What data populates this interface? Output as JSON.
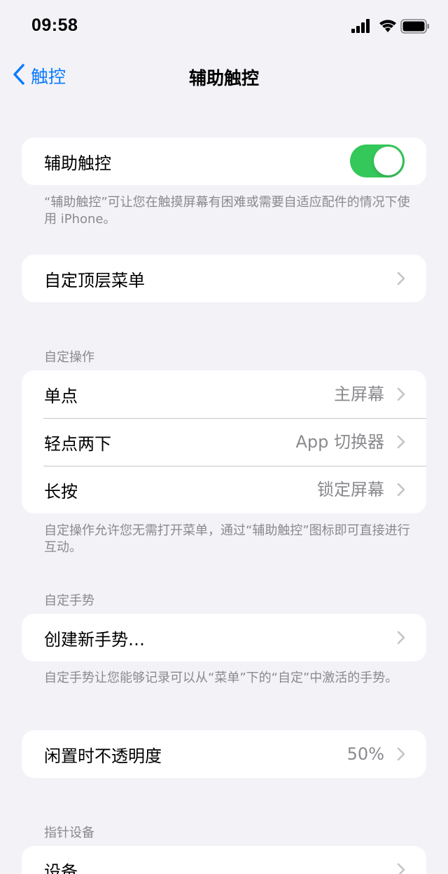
{
  "status_bar": {
    "time": "09:58",
    "icons": [
      "signal-icon",
      "wifi-icon",
      "battery-icon"
    ]
  },
  "nav": {
    "back_label": "触控",
    "title": "辅助触控"
  },
  "assistive_touch": {
    "label": "辅助触控",
    "toggle_on": true,
    "footer": "“辅助触控”可让您在触摸屏幕有困难或需要自适应配件的情况下使用 iPhone。"
  },
  "top_menu": {
    "label": "自定顶层菜单"
  },
  "custom_actions": {
    "header": "自定操作",
    "rows": [
      {
        "label": "单点",
        "value": "主屏幕"
      },
      {
        "label": "轻点两下",
        "value": "App 切换器"
      },
      {
        "label": "长按",
        "value": "锁定屏幕"
      }
    ],
    "footer": "自定操作允许您无需打开菜单，通过“辅助触控”图标即可直接进行互动。"
  },
  "custom_gestures": {
    "header": "自定手势",
    "create_label": "创建新手势…",
    "footer": "自定手势让您能够记录可以从“菜单”下的“自定”中激活的手势。"
  },
  "idle_opacity": {
    "label": "闲置时不透明度",
    "value": "50%"
  },
  "pointer_devices": {
    "header": "指针设备",
    "devices_label": "设备"
  },
  "colors": {
    "accent": "#0a7aff",
    "toggle_on": "#34c759",
    "background": "#f2f2f7",
    "secondary_text": "#8a8a8e"
  }
}
